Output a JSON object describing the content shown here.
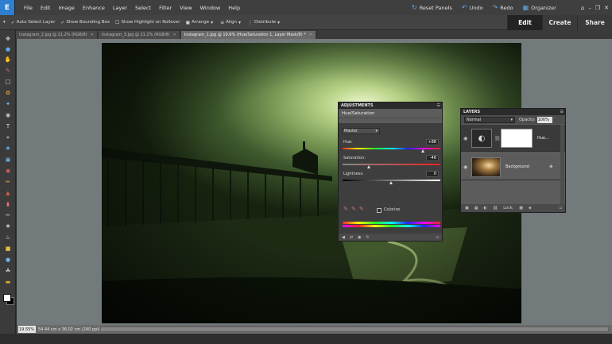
{
  "app": {
    "logo_text": "E"
  },
  "menu": [
    "File",
    "Edit",
    "Image",
    "Enhance",
    "Layer",
    "Select",
    "Filter",
    "View",
    "Window",
    "Help"
  ],
  "quick": {
    "reset": "Reset Panels",
    "undo": "Undo",
    "redo": "Redo",
    "organizer": "Organizer"
  },
  "modes": {
    "edit": "Edit",
    "create": "Create",
    "share": "Share"
  },
  "options": {
    "auto_select": "Auto Select Layer",
    "bounding_box": "Show Bounding Box",
    "highlight": "Show Highlight on Rollover",
    "arrange": "Arrange",
    "align": "Align",
    "distribute": "Distribute"
  },
  "tabs": [
    {
      "label": "Instagram_2.jpg @ 21.2% (RGB/8)"
    },
    {
      "label": "Instagram_3.jpg @ 21.2% (RGB/8)"
    },
    {
      "label": "Instagram_1.jpg @ 19.6% (Hue/Saturation 1, Layer Mask/8) *"
    }
  ],
  "adjustments": {
    "title": "ADJUSTMENTS",
    "name": "Hue/Saturation",
    "preset": "Master",
    "hue_label": "Hue:",
    "hue_value": "+88",
    "sat_label": "Saturation:",
    "sat_value": "-46",
    "light_label": "Lightness:",
    "light_value": "0",
    "colorize": "Colorize"
  },
  "layers": {
    "title": "LAYERS",
    "blend": "Normal",
    "opacity_label": "Opacity:",
    "opacity_value": "100%",
    "items": [
      {
        "name": "Hue..."
      },
      {
        "name": "Background"
      }
    ],
    "lock_label": "Lock:"
  },
  "status": {
    "zoom": "19.55%",
    "docinfo": "54.44 cm x 36.02 cm (240 ppi)"
  },
  "colors": {
    "accent": "#62a8ec",
    "tint": "#9fbf6e"
  }
}
